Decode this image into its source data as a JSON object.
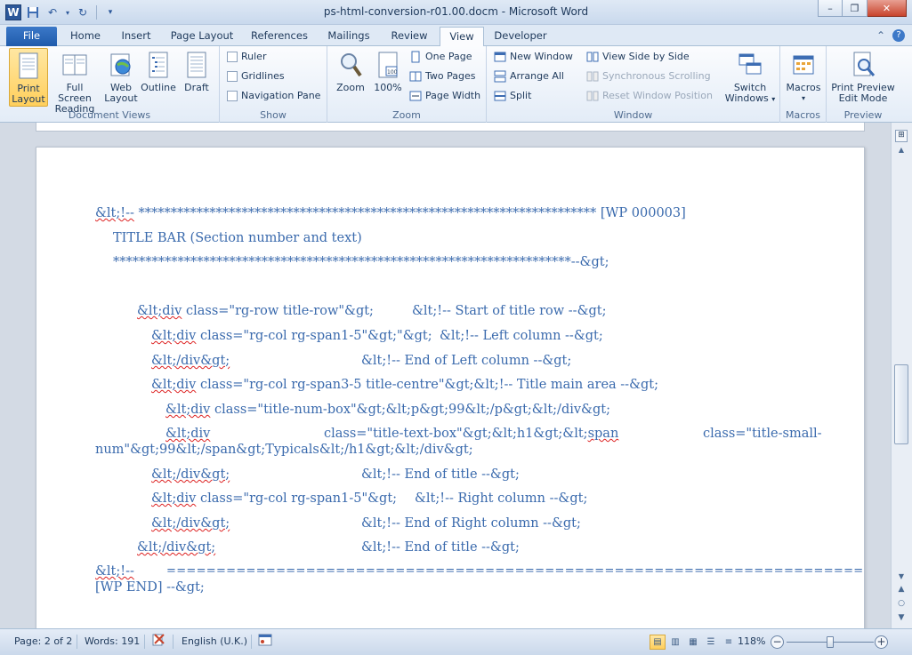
{
  "window": {
    "title": "ps-html-conversion-r01.00.docm - Microsoft Word",
    "minimize": "–",
    "restore": "❐",
    "close": "✕"
  },
  "tabs": {
    "file": "File",
    "items": [
      "Home",
      "Insert",
      "Page Layout",
      "References",
      "Mailings",
      "Review",
      "View",
      "Developer"
    ],
    "active": "View"
  },
  "ribbon": {
    "document_views": {
      "label": "Document Views",
      "print_layout": [
        "Print",
        "Layout"
      ],
      "full_screen_reading": [
        "Full Screen",
        "Reading"
      ],
      "web_layout": [
        "Web",
        "Layout"
      ],
      "outline": "Outline",
      "draft": "Draft"
    },
    "show": {
      "label": "Show",
      "ruler": "Ruler",
      "gridlines": "Gridlines",
      "navigation_pane": "Navigation Pane"
    },
    "zoom": {
      "label": "Zoom",
      "zoom": "Zoom",
      "hundred": "100%",
      "one_page": "One Page",
      "two_pages": "Two Pages",
      "page_width": "Page Width"
    },
    "window": {
      "label": "Window",
      "new_window": "New Window",
      "arrange_all": "Arrange All",
      "split": "Split",
      "view_side_by_side": "View Side by Side",
      "synchronous_scrolling": "Synchronous Scrolling",
      "reset_window_position": "Reset Window Position",
      "switch_windows": [
        "Switch",
        "Windows"
      ]
    },
    "macros": {
      "label": "Macros",
      "macros": "Macros"
    },
    "preview": {
      "label": "Preview",
      "print_preview": [
        "Print Preview",
        "Edit Mode"
      ]
    }
  },
  "document": {
    "lines": {
      "l1a": "&lt;!--",
      "l1b": " *********************************************************************** [WP 000003]",
      "l2": "TITLE BAR (Section number and text)",
      "l3": "***********************************************************************--&gt;",
      "l4a": "&lt;div",
      "l4b": " class=\"rg-row title-row\"&gt;",
      "l4c": "&lt;!-- Start of title row --&gt;",
      "l5a": "&lt;div",
      "l5b": " class=\"rg-col rg-span1-5\"&gt;\"&gt;",
      "l5c": "&lt;!-- Left column  --&gt;",
      "l6a": "&lt;/div&gt;",
      "l6c": "&lt;!-- End of Left column --&gt;",
      "l7a": "&lt;div",
      "l7b": " class=\"rg-col rg-span3-5 title-centre\"&gt;&lt;!-- Title main area --&gt;",
      "l8a": "&lt;div",
      "l8b": " class=\"title-num-box\"&gt;&lt;p&gt;99&lt;/p&gt;&lt;/div&gt;",
      "l9a": "&lt;div",
      "l9b": "class=\"title-text-box\"&gt;&lt;h1&gt;&lt;",
      "l9c": "span",
      "l9d": "class=\"title-small-",
      "l10": "num\"&gt;99&lt;/span&gt;Typicals&lt;/h1&gt;&lt;/div&gt;",
      "l11a": "&lt;/div&gt;",
      "l11c": "&lt;!-- End of title  --&gt;",
      "l12a": "&lt;div",
      "l12b": " class=\"rg-col rg-span1-5\"&gt;",
      "l12c": "&lt;!-- Right column  --&gt;",
      "l13a": "&lt;/div&gt;",
      "l13c": "&lt;!-- End of Right column --&gt;",
      "l14a": "&lt;/div&gt;",
      "l14c": "&lt;!-- End of title --&gt;",
      "l15a": "&lt;!--",
      "l15b": "======================================================================",
      "l16": "[WP END] --&gt;"
    }
  },
  "status": {
    "page": "Page: 2 of 2",
    "words": "Words: 191",
    "language": "English (U.K.)",
    "zoom_level": "118%",
    "zoom_out": "−",
    "zoom_in": "+"
  },
  "colors": {
    "accent": "#2b579a",
    "text_blue": "#3a6aad"
  }
}
